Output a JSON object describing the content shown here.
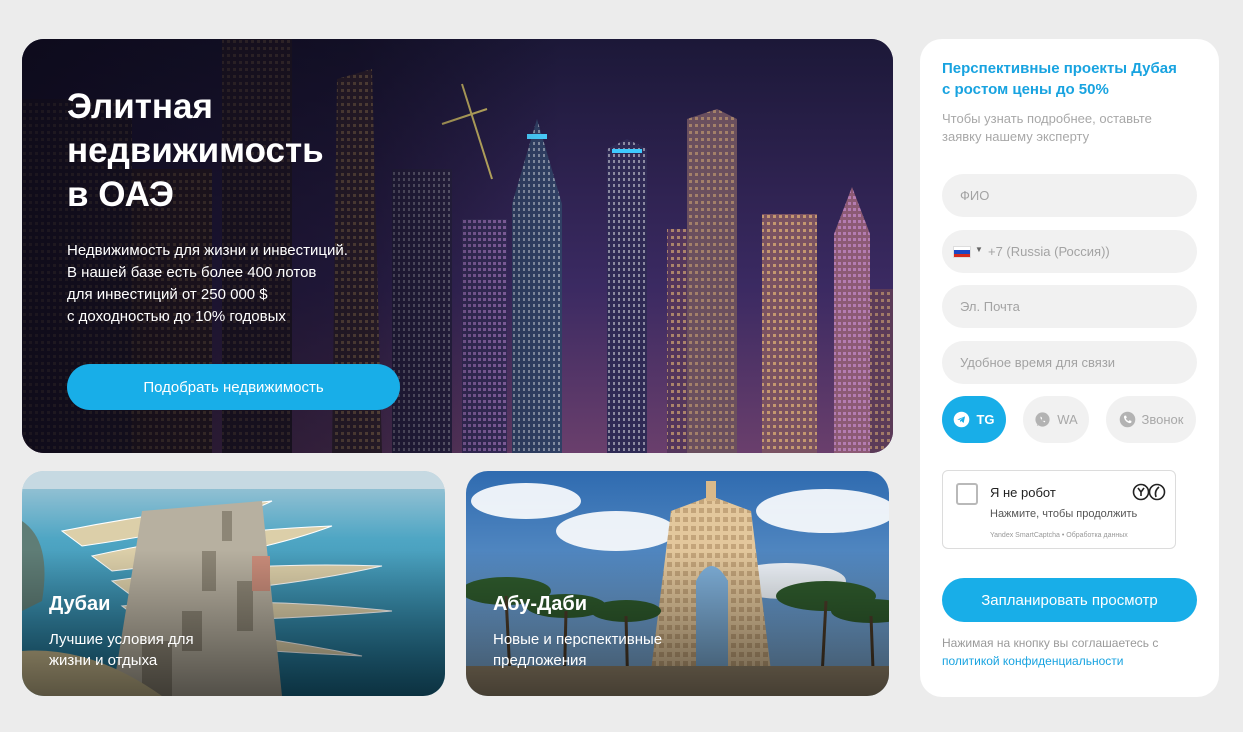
{
  "hero": {
    "title_lines": [
      "Элитная",
      "недвижимость",
      "в ОАЭ"
    ],
    "text_lines": [
      "Недвижимость для жизни и инвестиций.",
      "В нашей базе есть более 400 лотов",
      "для инвестиций от 250 000 $",
      "с доходностью до 10% годовых"
    ],
    "button_label": "Подобрать недвижимость"
  },
  "cards": [
    {
      "title": "Дубаи",
      "text_lines": [
        "Лучшие условия для",
        "жизни и отдыха"
      ]
    },
    {
      "title": "Абу-Даби",
      "text_lines": [
        "Новые и перспективные",
        "предложения"
      ]
    }
  ],
  "form": {
    "title_lines": [
      "Перспективные проекты Дубая",
      "с ростом цены до 50%"
    ],
    "subtitle_lines": [
      "Чтобы узнать подробнее, оставьте",
      "заявку нашему эксперту"
    ],
    "name_placeholder": "ФИО",
    "phone_placeholder": "+7 (Russia (Россия))",
    "email_placeholder": "Эл. Почта",
    "time_placeholder": "Удобное время для связи",
    "messengers": {
      "tg": "TG",
      "wa": "WA",
      "call": "Звонок"
    },
    "captcha": {
      "label": "Я не робот",
      "hint": "Нажмите, чтобы продолжить",
      "footer": "Yandex SmartCaptcha • Обработка данных"
    },
    "submit_label": "Запланировать просмотр",
    "consent_text": "Нажимая на кнопку вы соглашаетесь с",
    "consent_link": "политикой конфиденциальности"
  },
  "colors": {
    "accent": "#18aee8",
    "accent_text": "#18a3e0",
    "field_bg": "#f1f1f1",
    "page_bg": "#ececec"
  },
  "icons": {
    "flag": "russia-flag-icon",
    "tg": "telegram-icon",
    "wa": "whatsapp-icon",
    "call": "phone-icon",
    "captcha": "yandex-captcha-logo"
  }
}
